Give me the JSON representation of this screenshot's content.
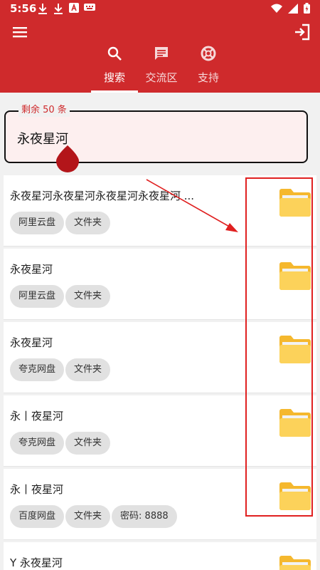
{
  "status_bar": {
    "time": "5:56",
    "left_icons": [
      "download-icon",
      "download-icon",
      "font-app-icon",
      "keyboard-icon"
    ],
    "right_icons": [
      "wifi-icon",
      "signal-icon",
      "battery-icon"
    ]
  },
  "header": {
    "background": "#cf2a2c",
    "menu_icon": "menu-icon",
    "logout_icon": "logout-icon",
    "tabs": [
      {
        "label": "搜索",
        "icon": "search-icon",
        "active": true
      },
      {
        "label": "交流区",
        "icon": "chat-icon",
        "active": false
      },
      {
        "label": "支持",
        "icon": "support-icon",
        "active": false
      }
    ]
  },
  "search": {
    "legend": "剩余 50 条",
    "value": "永夜星河"
  },
  "results": [
    {
      "title": "永夜星河永夜星河永夜星河永夜星河 ...",
      "tags": [
        "阿里云盘",
        "文件夹"
      ],
      "icon": "folder-icon"
    },
    {
      "title": "永夜星河",
      "tags": [
        "阿里云盘",
        "文件夹"
      ],
      "icon": "folder-icon"
    },
    {
      "title": "永夜星河",
      "tags": [
        "夸克网盘",
        "文件夹"
      ],
      "icon": "folder-icon"
    },
    {
      "title": "永丨夜星河",
      "tags": [
        "夸克网盘",
        "文件夹"
      ],
      "icon": "folder-icon"
    },
    {
      "title": "永丨夜星河",
      "tags": [
        "百度网盘",
        "文件夹",
        "密码: 8888"
      ],
      "icon": "folder-icon"
    },
    {
      "title": "Y 永夜星河",
      "tags": [],
      "icon": "folder-icon"
    }
  ],
  "annotation_color": "#e02020"
}
